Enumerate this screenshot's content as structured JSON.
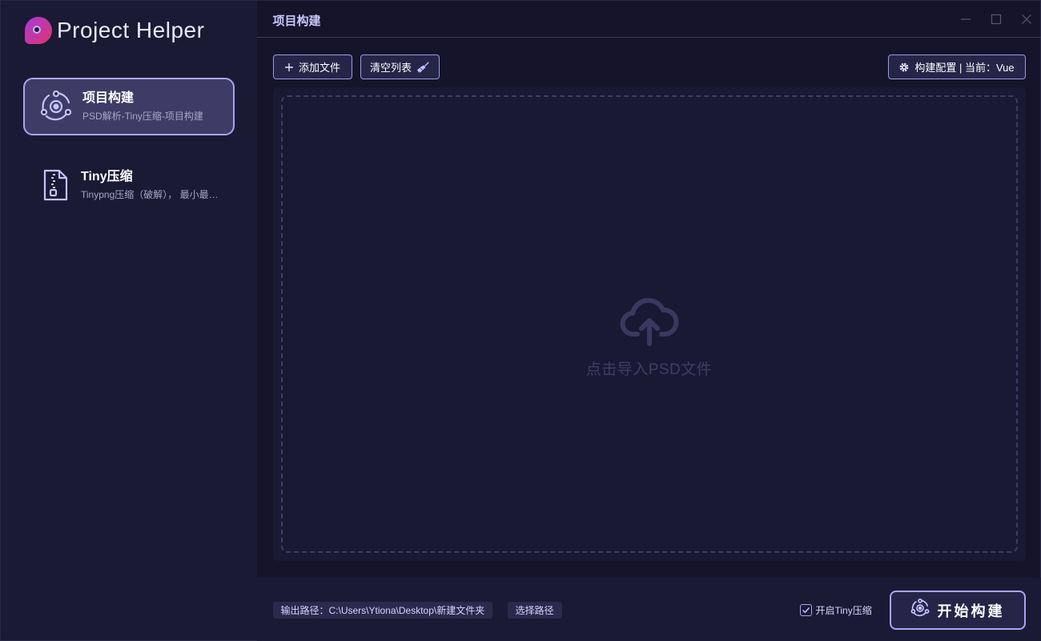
{
  "app": {
    "name": "Project Helper"
  },
  "sidebar": {
    "items": [
      {
        "title": "项目构建",
        "subtitle": "PSD解析-Tiny压缩-项目构建",
        "icon": "project-build-icon",
        "active": true
      },
      {
        "title": "Tiny压缩",
        "subtitle": "Tinypng压缩（破解）， 最小最优压缩",
        "icon": "zip-file-icon",
        "active": false
      }
    ]
  },
  "header": {
    "title": "项目构建",
    "window_controls": [
      "minimize-icon",
      "maximize-icon",
      "close-icon"
    ]
  },
  "toolbar": {
    "add_label": "添加文件",
    "clear_label": "清空列表",
    "config_label": "构建配置 | 当前：Vue"
  },
  "dropzone": {
    "text": "点击导入PSD文件",
    "icon": "cloud-upload-icon"
  },
  "footer": {
    "output_path": "输出路径：C:\\Users\\Ytiona\\Desktop\\新建文件夹",
    "choose_label": "选择路径",
    "tiny_label": "开启Tiny压缩",
    "tiny_checked": true,
    "start_label": "开始构建"
  },
  "colors": {
    "accent": "#a9a4f3",
    "sidebar_bg": "#1b1a34",
    "main_bg": "#15142a",
    "active_item_bg": "#3e3c66",
    "logo_gradient": [
      "#a73bd8",
      "#e0336f"
    ]
  }
}
